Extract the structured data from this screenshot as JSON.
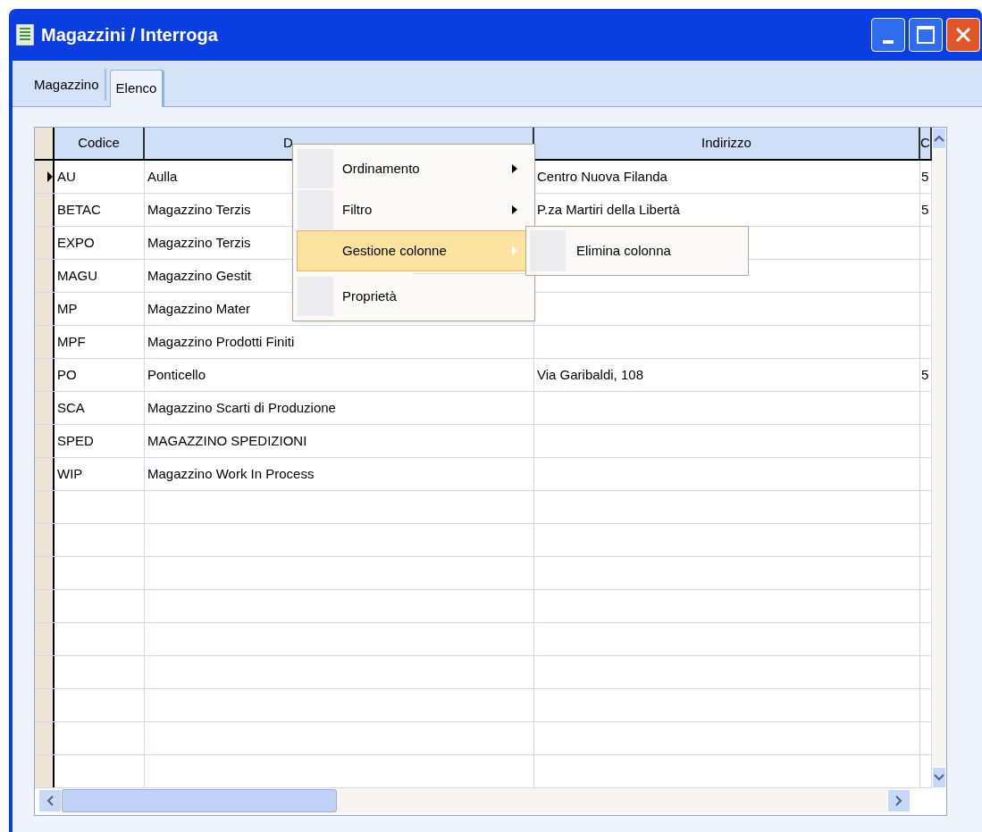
{
  "window": {
    "title": "Magazzini / Interroga"
  },
  "tabs": [
    {
      "label": "Magazzino",
      "selected": false
    },
    {
      "label": "Elenco",
      "selected": true
    }
  ],
  "table": {
    "columns": [
      "Codice",
      "D",
      "Indirizzo",
      "C"
    ],
    "rows": [
      {
        "current": true,
        "cells": [
          "AU",
          "Aulla",
          "Centro Nuova Filanda",
          "5"
        ]
      },
      {
        "current": false,
        "cells": [
          "BETAC",
          "Magazzino Terzis",
          "P.za Martiri della Libertà",
          "5"
        ]
      },
      {
        "current": false,
        "cells": [
          "EXPO",
          "Magazzino Terzis",
          "",
          ""
        ]
      },
      {
        "current": false,
        "cells": [
          "MAGU",
          "Magazzino Gestit",
          "",
          ""
        ]
      },
      {
        "current": false,
        "cells": [
          "MP",
          "Magazzino Mater",
          "",
          ""
        ]
      },
      {
        "current": false,
        "cells": [
          "MPF",
          "Magazzino Prodotti Finiti",
          "",
          ""
        ]
      },
      {
        "current": false,
        "cells": [
          "PO",
          "Ponticello",
          "Via Garibaldi, 108",
          "5"
        ]
      },
      {
        "current": false,
        "cells": [
          "SCA",
          "Magazzino Scarti di Produzione",
          "",
          ""
        ]
      },
      {
        "current": false,
        "cells": [
          "SPED",
          "MAGAZZINO SPEDIZIONI",
          "",
          ""
        ]
      },
      {
        "current": false,
        "cells": [
          "WIP",
          "Magazzino Work In Process",
          "",
          ""
        ]
      }
    ]
  },
  "context_menu": {
    "items": [
      {
        "label": "Ordinamento",
        "submenu": true,
        "selected": false
      },
      {
        "label": "Filtro",
        "submenu": true,
        "selected": false
      },
      {
        "label": "Gestione colonne",
        "submenu": true,
        "selected": true
      },
      {
        "label": "Proprietà",
        "submenu": false,
        "selected": false
      }
    ],
    "submenu": {
      "items": [
        {
          "label": "Elimina colonna",
          "selected": false
        }
      ]
    }
  }
}
